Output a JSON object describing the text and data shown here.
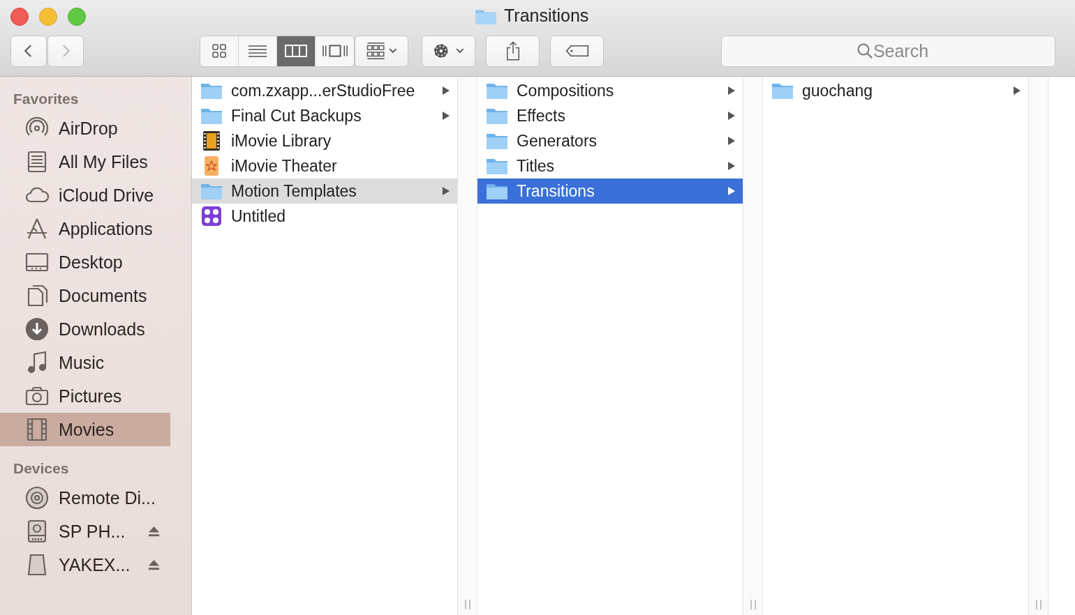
{
  "window": {
    "title": "Transitions"
  },
  "toolbar": {
    "back": {
      "disabled": false
    },
    "forward": {
      "disabled": true
    },
    "views": [
      {
        "kind": "icons",
        "selected": false
      },
      {
        "kind": "list",
        "selected": false
      },
      {
        "kind": "columns",
        "selected": true
      },
      {
        "kind": "gallery",
        "selected": false
      }
    ],
    "search": {
      "placeholder": "Search"
    }
  },
  "sidebar": {
    "sections": [
      {
        "title": "Favorites",
        "items": [
          {
            "label": "AirDrop",
            "kind": "airdrop",
            "selected": false
          },
          {
            "label": "All My Files",
            "kind": "files",
            "selected": false
          },
          {
            "label": "iCloud Drive",
            "kind": "cloud",
            "selected": false
          },
          {
            "label": "Applications",
            "kind": "apps",
            "selected": false
          },
          {
            "label": "Desktop",
            "kind": "desktop",
            "selected": false
          },
          {
            "label": "Documents",
            "kind": "document",
            "selected": false
          },
          {
            "label": "Downloads",
            "kind": "download",
            "selected": false
          },
          {
            "label": "Music",
            "kind": "music",
            "selected": false
          },
          {
            "label": "Pictures",
            "kind": "camera",
            "selected": false
          },
          {
            "label": "Movies",
            "kind": "film",
            "selected": true
          }
        ]
      },
      {
        "title": "Devices",
        "items": [
          {
            "label": "Remote Di...",
            "kind": "disc",
            "selected": false,
            "eject": false
          },
          {
            "label": "SP PH...",
            "kind": "drive",
            "selected": false,
            "eject": true
          },
          {
            "label": "YAKEX...",
            "kind": "volume",
            "selected": false,
            "eject": true
          }
        ]
      }
    ]
  },
  "columns": [
    {
      "items": [
        {
          "label": "com.zxapp...erStudioFree",
          "kind": "folder",
          "expandable": true,
          "selected": false
        },
        {
          "label": "Final Cut Backups",
          "kind": "folder",
          "expandable": true,
          "selected": false
        },
        {
          "label": "iMovie Library",
          "kind": "library",
          "expandable": false,
          "selected": false
        },
        {
          "label": "iMovie Theater",
          "kind": "theater",
          "expandable": false,
          "selected": false
        },
        {
          "label": "Motion Templates",
          "kind": "folder",
          "expandable": true,
          "selected": true
        },
        {
          "label": "Untitled",
          "kind": "app",
          "expandable": false,
          "selected": false
        }
      ]
    },
    {
      "items": [
        {
          "label": "Compositions",
          "kind": "folder",
          "expandable": true,
          "selected": false
        },
        {
          "label": "Effects",
          "kind": "folder",
          "expandable": true,
          "selected": false
        },
        {
          "label": "Generators",
          "kind": "folder",
          "expandable": true,
          "selected": false
        },
        {
          "label": "Titles",
          "kind": "folder",
          "expandable": true,
          "selected": false
        },
        {
          "label": "Transitions",
          "kind": "folder",
          "expandable": true,
          "selected": true
        }
      ]
    },
    {
      "items": [
        {
          "label": "guochang",
          "kind": "folder",
          "expandable": true,
          "selected": false
        }
      ]
    }
  ]
}
